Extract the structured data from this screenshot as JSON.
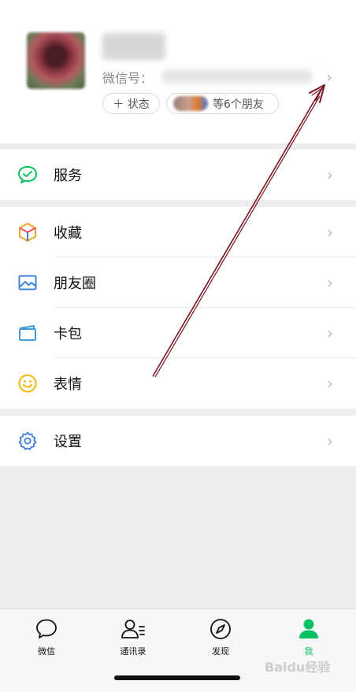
{
  "profile": {
    "wechat_id_label": "微信号：",
    "chevron": "›",
    "status_label": "＋ 状态",
    "friends_label": "等6个朋友"
  },
  "menu": {
    "service": {
      "label": "服务",
      "icon": "service-icon"
    },
    "favorites": {
      "label": "收藏",
      "icon": "cube-icon"
    },
    "moments": {
      "label": "朋友圈",
      "icon": "image-icon"
    },
    "cards": {
      "label": "卡包",
      "icon": "wallet-icon"
    },
    "stickers": {
      "label": "表情",
      "icon": "smiley-icon"
    },
    "settings": {
      "label": "设置",
      "icon": "gear-icon"
    },
    "chevron": "›"
  },
  "tabbar": {
    "tabs": [
      {
        "label": "微信",
        "icon": "chat-bubble-icon",
        "active": false
      },
      {
        "label": "通讯录",
        "icon": "contacts-icon",
        "active": false
      },
      {
        "label": "发现",
        "icon": "compass-icon",
        "active": false
      },
      {
        "label": "我",
        "icon": "person-icon",
        "active": true
      }
    ]
  },
  "colors": {
    "accent_green": "#07c160",
    "annotation_arrow": "#7a1420",
    "background": "#ededed"
  },
  "watermark": "Baidu经验"
}
